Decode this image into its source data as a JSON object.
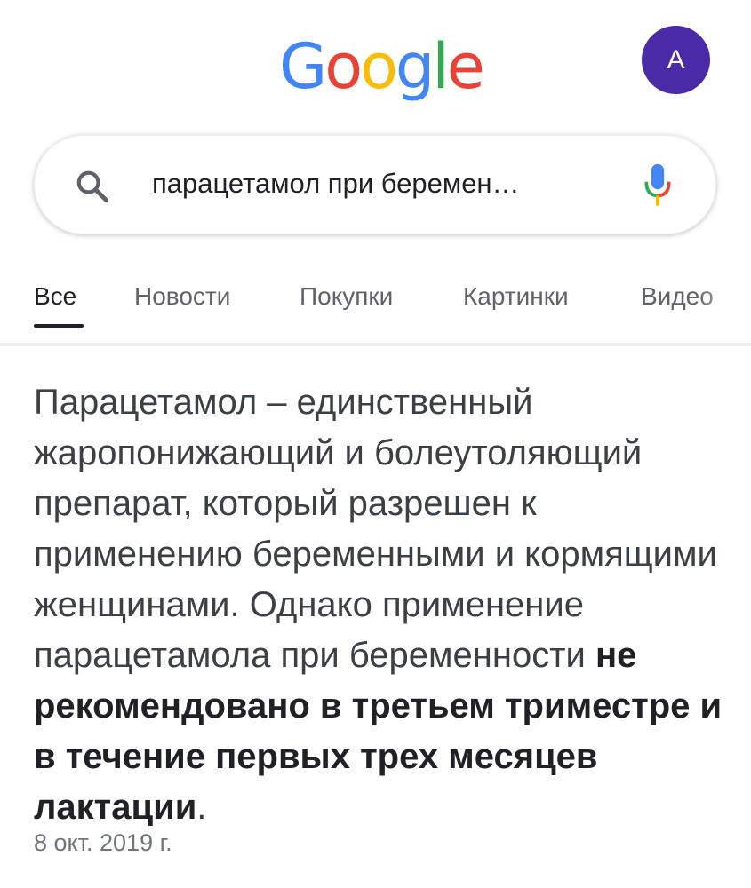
{
  "header": {
    "logo": {
      "letters": [
        "G",
        "o",
        "o",
        "g",
        "l",
        "e"
      ],
      "colors": [
        "#4285F4",
        "#EA4335",
        "#FBBC05",
        "#4285F4",
        "#34A853",
        "#EA4335"
      ]
    },
    "avatar": {
      "initial": "A",
      "color": "#4a2aa6"
    }
  },
  "search": {
    "query": "парацетамол при беремен…",
    "icons": {
      "left": "search-icon",
      "right": "microphone-icon"
    }
  },
  "tabs": [
    {
      "label": "Все",
      "active": true
    },
    {
      "label": "Новости",
      "active": false
    },
    {
      "label": "Покупки",
      "active": false
    },
    {
      "label": "Картинки",
      "active": false
    },
    {
      "label": "Видео",
      "active": false
    }
  ],
  "result": {
    "snippet_text": "Парацетамол – единственный жаропонижающий и болеутоляющий препарат, который разрешен к применению беременными и кормящими женщинами. Однако применение парацетамола при беременности ",
    "snippet_bold": "не рекомендовано в третьем триместре и в течение первых трех месяцев лактации",
    "snippet_end": ".",
    "date": "8 окт. 2019 г."
  }
}
